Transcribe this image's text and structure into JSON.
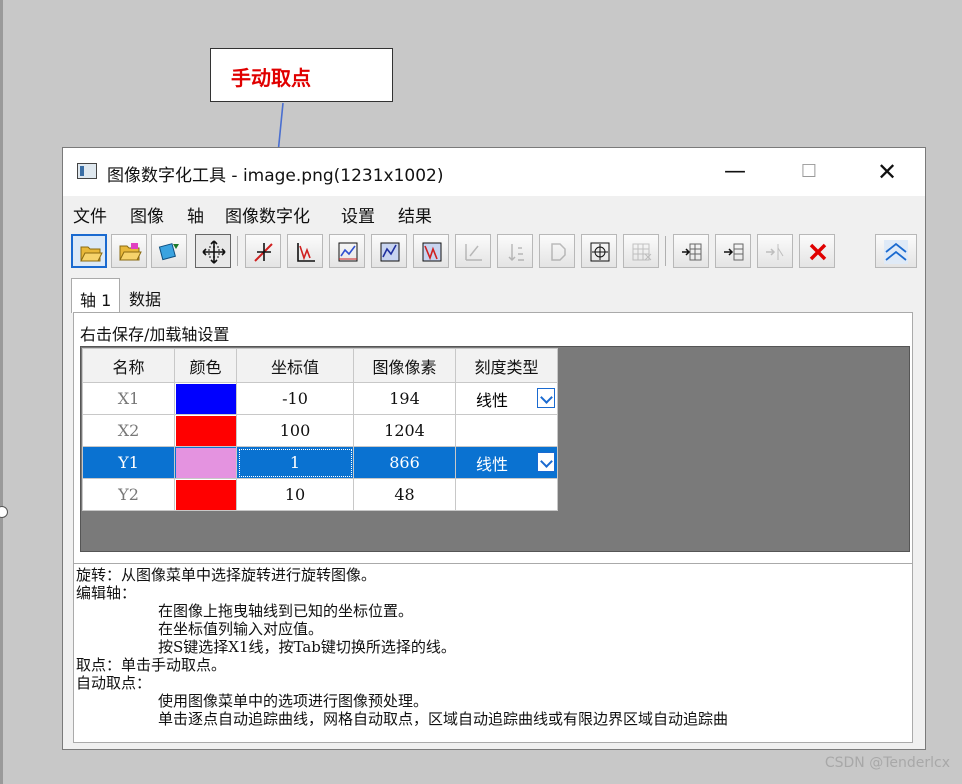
{
  "annotation": {
    "label": "手动取点"
  },
  "window": {
    "title": "图像数字化工具 - image.png(1231x1002)",
    "controls": {
      "minimize": "—",
      "maximize": "☐",
      "close": "✕"
    }
  },
  "menu": {
    "items": [
      "文件",
      "图像",
      "轴",
      "图像数字化",
      "设置",
      "结果"
    ]
  },
  "toolbar": {
    "buttons": [
      "open-file",
      "open-folder",
      "refresh-image",
      "move-axes",
      "manual-pick",
      "auto-digitize",
      "point-by-point",
      "grid-pick",
      "region-trace",
      "reverse-axis",
      "sort",
      "mask",
      "snap",
      "grid",
      "add-row",
      "insert-col",
      "remove-row",
      "delete",
      "collapse"
    ]
  },
  "tabs": [
    {
      "label": "轴 1"
    },
    {
      "label": "数据"
    }
  ],
  "panel": {
    "hint": "右击保存/加载轴设置",
    "table": {
      "headers": [
        "名称",
        "颜色",
        "坐标值",
        "图像像素",
        "刻度类型"
      ],
      "rows": [
        {
          "name": "X1",
          "color": "#0000ff",
          "value": "-10",
          "pixel": "194",
          "scale": "线性"
        },
        {
          "name": "X2",
          "color": "#ff0000",
          "value": "100",
          "pixel": "1204",
          "scale": ""
        },
        {
          "name": "Y1",
          "color": "#e493e0",
          "value": "1",
          "pixel": "866",
          "scale": "线性"
        },
        {
          "name": "Y2",
          "color": "#ff0000",
          "value": "10",
          "pixel": "48",
          "scale": ""
        }
      ]
    },
    "log": [
      "旋转：从图像菜单中选择旋转进行旋转图像。",
      "编辑轴：",
      "在图像上拖曳轴线到已知的坐标位置。",
      "在坐标值列输入对应值。",
      "按S键选择X1线，按Tab键切换所选择的线。",
      "取点：单击手动取点。",
      "自动取点：",
      "使用图像菜单中的选项进行图像预处理。",
      "单击逐点自动追踪曲线，网格自动取点，区域自动追踪曲线或有限边界区域自动追踪曲"
    ]
  },
  "watermark": "CSDN @Tenderlcx"
}
